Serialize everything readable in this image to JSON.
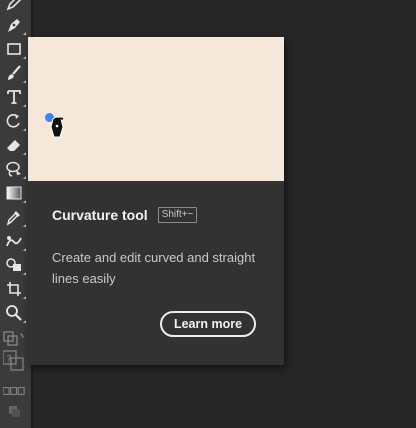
{
  "toolbar": {
    "tools": [
      {
        "name": "pencil-tool",
        "icon": "pencil-icon"
      },
      {
        "name": "pen-tool",
        "icon": "pen-nib-icon"
      },
      {
        "name": "rectangle-tool",
        "icon": "rectangle-icon"
      },
      {
        "name": "paintbrush-tool",
        "icon": "paintbrush-icon"
      },
      {
        "name": "type-tool",
        "icon": "type-t-icon"
      },
      {
        "name": "rotate-tool",
        "icon": "rotate-icon"
      },
      {
        "name": "eraser-tool",
        "icon": "eraser-icon"
      },
      {
        "name": "lasso-tool",
        "icon": "lasso-icon"
      },
      {
        "name": "gradient-tool",
        "icon": "gradient-icon"
      },
      {
        "name": "eyedropper-tool",
        "icon": "eyedropper-icon"
      },
      {
        "name": "blend-tool",
        "icon": "blend-icon"
      },
      {
        "name": "shape-builder-tool",
        "icon": "shape-builder-icon"
      },
      {
        "name": "artboard-tool",
        "icon": "artboard-icon"
      },
      {
        "name": "zoom-tool",
        "icon": "magnifier-icon"
      },
      {
        "name": "fill-stroke-swatch",
        "icon": "fill-stroke-icon"
      },
      {
        "name": "edit-toolbar",
        "icon": "help-icon"
      },
      {
        "name": "screen-mode",
        "icon": "screen-mode-icon"
      }
    ]
  },
  "tooltip": {
    "title": "Curvature tool",
    "shortcut": "Shift+~",
    "description": "Create and edit curved and straight lines easily",
    "learn_more": "Learn more",
    "preview_bg": "#f6e7db",
    "anchor_color": "#3d83f0"
  }
}
